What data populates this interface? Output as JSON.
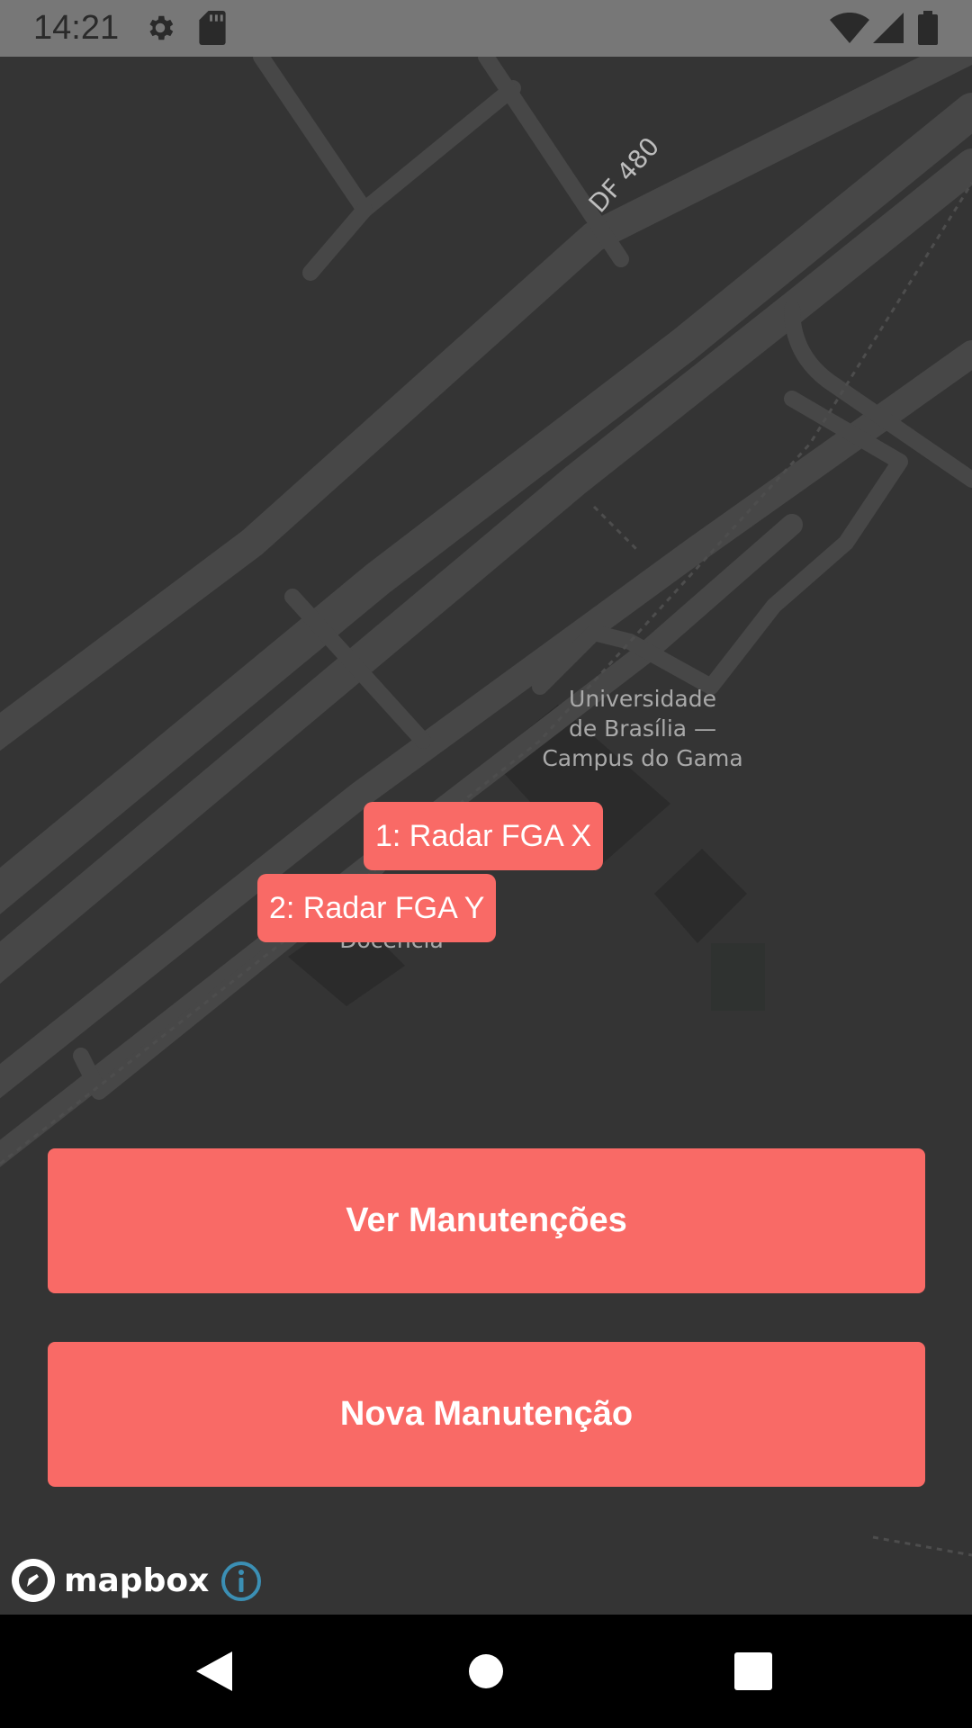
{
  "status_bar": {
    "time": "14:21",
    "icons": [
      "gear-icon",
      "sd-card-icon",
      "wifi-icon",
      "cell-signal-icon",
      "battery-icon"
    ]
  },
  "map": {
    "road_label": "DF 480",
    "place_label": "Universidade\nde Brasília —\nCampus do Gama",
    "partial_label": "Docência",
    "markers": [
      {
        "label": "1: Radar FGA X"
      },
      {
        "label": "2: Radar FGA Y"
      }
    ]
  },
  "buttons": {
    "ver_manutencoes": "Ver Manutenções",
    "nova_manutencao": "Nova Manutenção"
  },
  "attribution": {
    "logo_text": "mapbox",
    "info_icon": "info-icon"
  },
  "nav_bar": {
    "icons": [
      "back-icon",
      "home-icon",
      "recents-icon"
    ]
  },
  "colors": {
    "accent": "#f96a66",
    "map_background": "#343434",
    "road": "#474747",
    "status_bar": "#777777",
    "nav_bar": "#000000",
    "info_icon": "#3b8fb4"
  }
}
